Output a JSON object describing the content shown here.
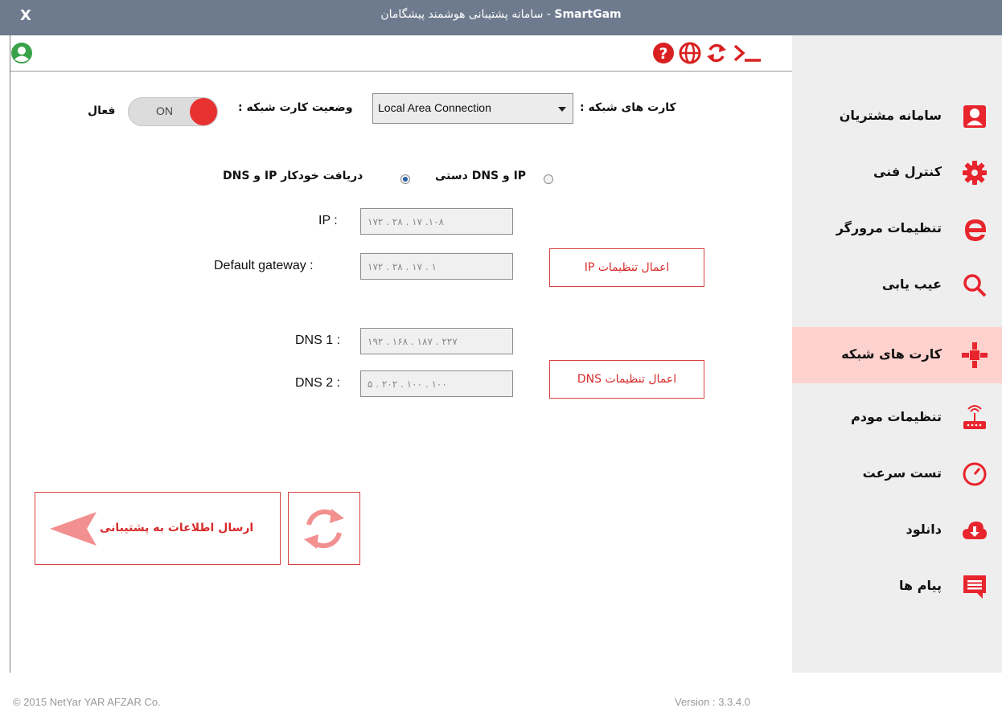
{
  "window": {
    "close_label": "X",
    "title_prefix": "سامانه پشتیبانی هوشمند پیشگامان - ",
    "title_brand": "SmartGam"
  },
  "form": {
    "network_cards_label": "کارت های شبکه :",
    "network_card_selected": "Local Area Connection",
    "card_status_label": "وضعیت کارت شبکه :",
    "toggle_text": "ON",
    "status_value": "فعال",
    "radio_auto_label": "دریافت خودکار IP و DNS",
    "radio_manual_label": "IP و DNS دستی",
    "ip_label": "IP :",
    "ip_value": "۱۷۲ . ۲۸ . ۱۷ .۱۰۸",
    "gateway_label": "Default gateway :",
    "gateway_value": "۱۷۲ . ۲۸ . ۱۷ . ۱",
    "dns1_label": "DNS 1 :",
    "dns1_value": "۱۹۲ . ۱۶۸ . ۱۸۷ . ۲۲۷",
    "dns2_label": "DNS 2 :",
    "dns2_value": "۵ . ۲۰۲ . ۱۰۰ . ۱۰۰",
    "apply_ip_label": "اعمال تنظیمات IP",
    "apply_dns_label": "اعمال تنظیمات DNS",
    "send_label": "ارسال اطلاعات به پشتیبانی"
  },
  "sidebar": {
    "items": [
      {
        "label": "سامانه مشتریان",
        "icon": "user-icon"
      },
      {
        "label": "کنترل فنی",
        "icon": "gear-icon"
      },
      {
        "label": "تنظیمات مرورگر",
        "icon": "browser-icon"
      },
      {
        "label": "عیب یابی",
        "icon": "search-icon"
      },
      {
        "label": "کارت های شبکه",
        "icon": "network-icon"
      },
      {
        "label": "تنظیمات مودم",
        "icon": "router-icon"
      },
      {
        "label": "تست سرعت",
        "icon": "speedometer-icon"
      },
      {
        "label": "دانلود",
        "icon": "cloud-download-icon"
      },
      {
        "label": "پیام ها",
        "icon": "message-icon"
      }
    ],
    "active_index": 4
  },
  "footer": {
    "copyright": "© 2015 NetYar YAR AFZAR Co.",
    "version": "Version : 3.3.4.0"
  },
  "colors": {
    "accent": "#e83131",
    "titlebar": "#6e7b8f",
    "active_nav": "#fdd1cd"
  }
}
